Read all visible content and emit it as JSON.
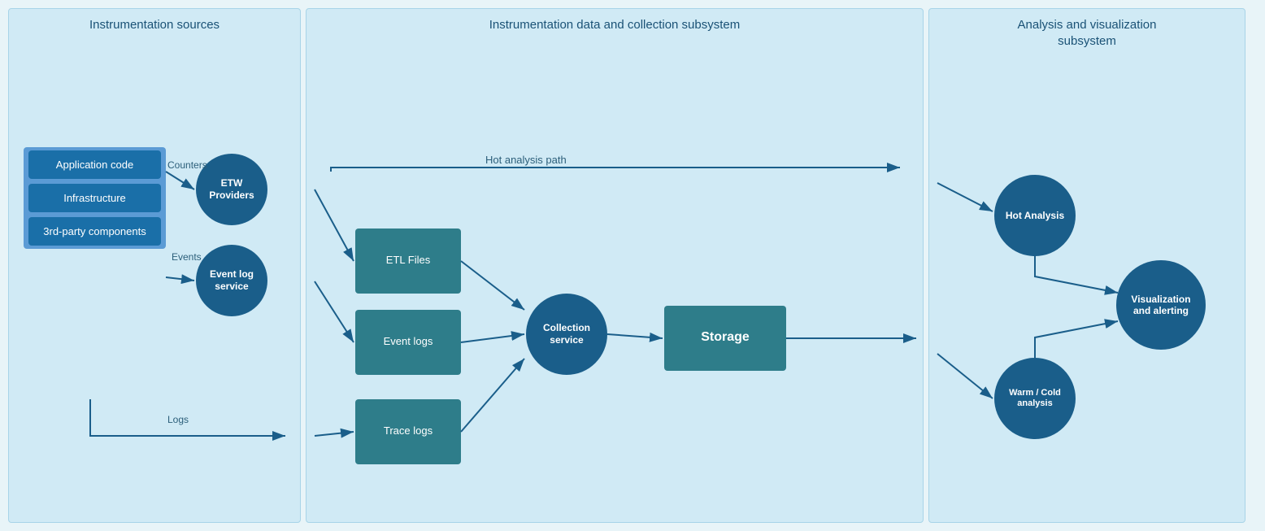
{
  "panels": {
    "left": {
      "title": "Instrumentation sources",
      "source_boxes": [
        "Application code",
        "Infrastructure",
        "3rd-party components"
      ],
      "etw_label": "ETW\nProviders",
      "evlog_label": "Event log\nservice"
    },
    "middle": {
      "title": "Instrumentation data and collection subsystem",
      "etl_label": "ETL Files",
      "evlogs_label": "Event logs",
      "tracelogs_label": "Trace logs",
      "collection_label": "Collection\nservice",
      "storage_label": "Storage",
      "hot_path_label": "Hot analysis path"
    },
    "right": {
      "title": "Analysis and visualization\nsubsystem",
      "hot_label": "Hot Analysis",
      "viz_label": "Visualization\nand alerting",
      "warm_label": "Warm / Cold\nanalysis"
    }
  },
  "labels": {
    "counters": "Counters",
    "events": "Events",
    "logs": "Logs"
  }
}
